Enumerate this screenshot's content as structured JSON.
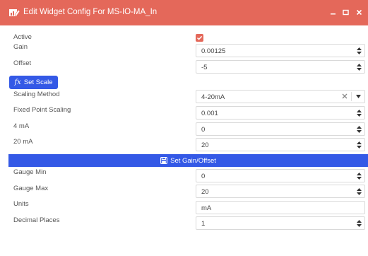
{
  "window": {
    "title": "Edit Widget Config For MS-IO-MA_In",
    "title_icon": "chart-widget-icon",
    "controls": [
      "minimize-icon",
      "maximize-icon",
      "close-icon"
    ]
  },
  "form": {
    "active": {
      "label": "Active",
      "checked": true
    },
    "gain": {
      "label": "Gain",
      "value": "0.00125"
    },
    "offset": {
      "label": "Offset",
      "value": "-5"
    },
    "set_scale_button": {
      "icon": "fx",
      "label": "Set Scale"
    },
    "scaling_method": {
      "label": "Scaling Method",
      "value": "4-20mA"
    },
    "fixed_point_scaling": {
      "label": "Fixed Point Scaling",
      "value": "0.001"
    },
    "ma4": {
      "label": "4 mA",
      "value": "0"
    },
    "ma20": {
      "label": "20 mA",
      "value": "20"
    },
    "set_gain_offset_button": {
      "icon": "save-icon",
      "label": "Set Gain/Offset"
    },
    "gauge_min": {
      "label": "Gauge Min",
      "value": "0"
    },
    "gauge_max": {
      "label": "Gauge Max",
      "value": "20"
    },
    "units": {
      "label": "Units",
      "value": "mA"
    },
    "decimal_places": {
      "label": "Decimal Places",
      "value": "1"
    }
  },
  "colors": {
    "header": "#e4685a",
    "accent_blue": "#3459e6",
    "checkbox": "#e4685a"
  }
}
